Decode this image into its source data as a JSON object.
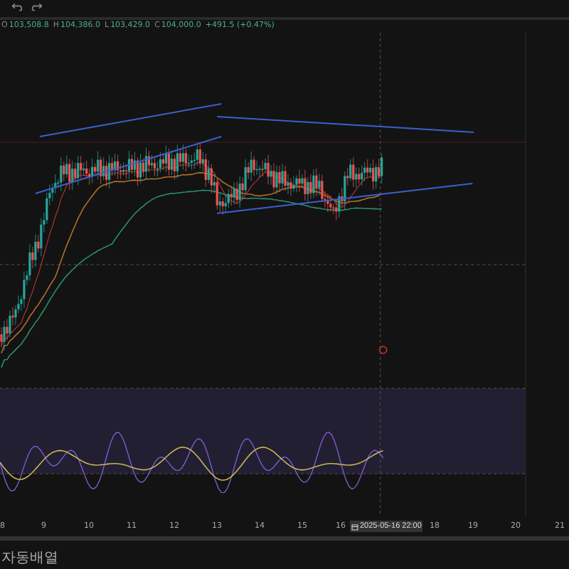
{
  "legend": [
    {
      "label": "O",
      "value": "103,508.8"
    },
    {
      "label": "H",
      "value": "104,386.0"
    },
    {
      "label": "L",
      "value": "103,429.0"
    },
    {
      "label": "C",
      "value": "104,000.0"
    },
    {
      "value": "+491.5 (+0.47%)"
    }
  ],
  "time_axis": [
    "8",
    "9",
    "10",
    "11",
    "12",
    "13",
    "14",
    "15",
    "16",
    "18",
    "19",
    "20",
    "21"
  ],
  "crosshair_label": "2025-05-16 22:00",
  "footer": "자동배열"
}
